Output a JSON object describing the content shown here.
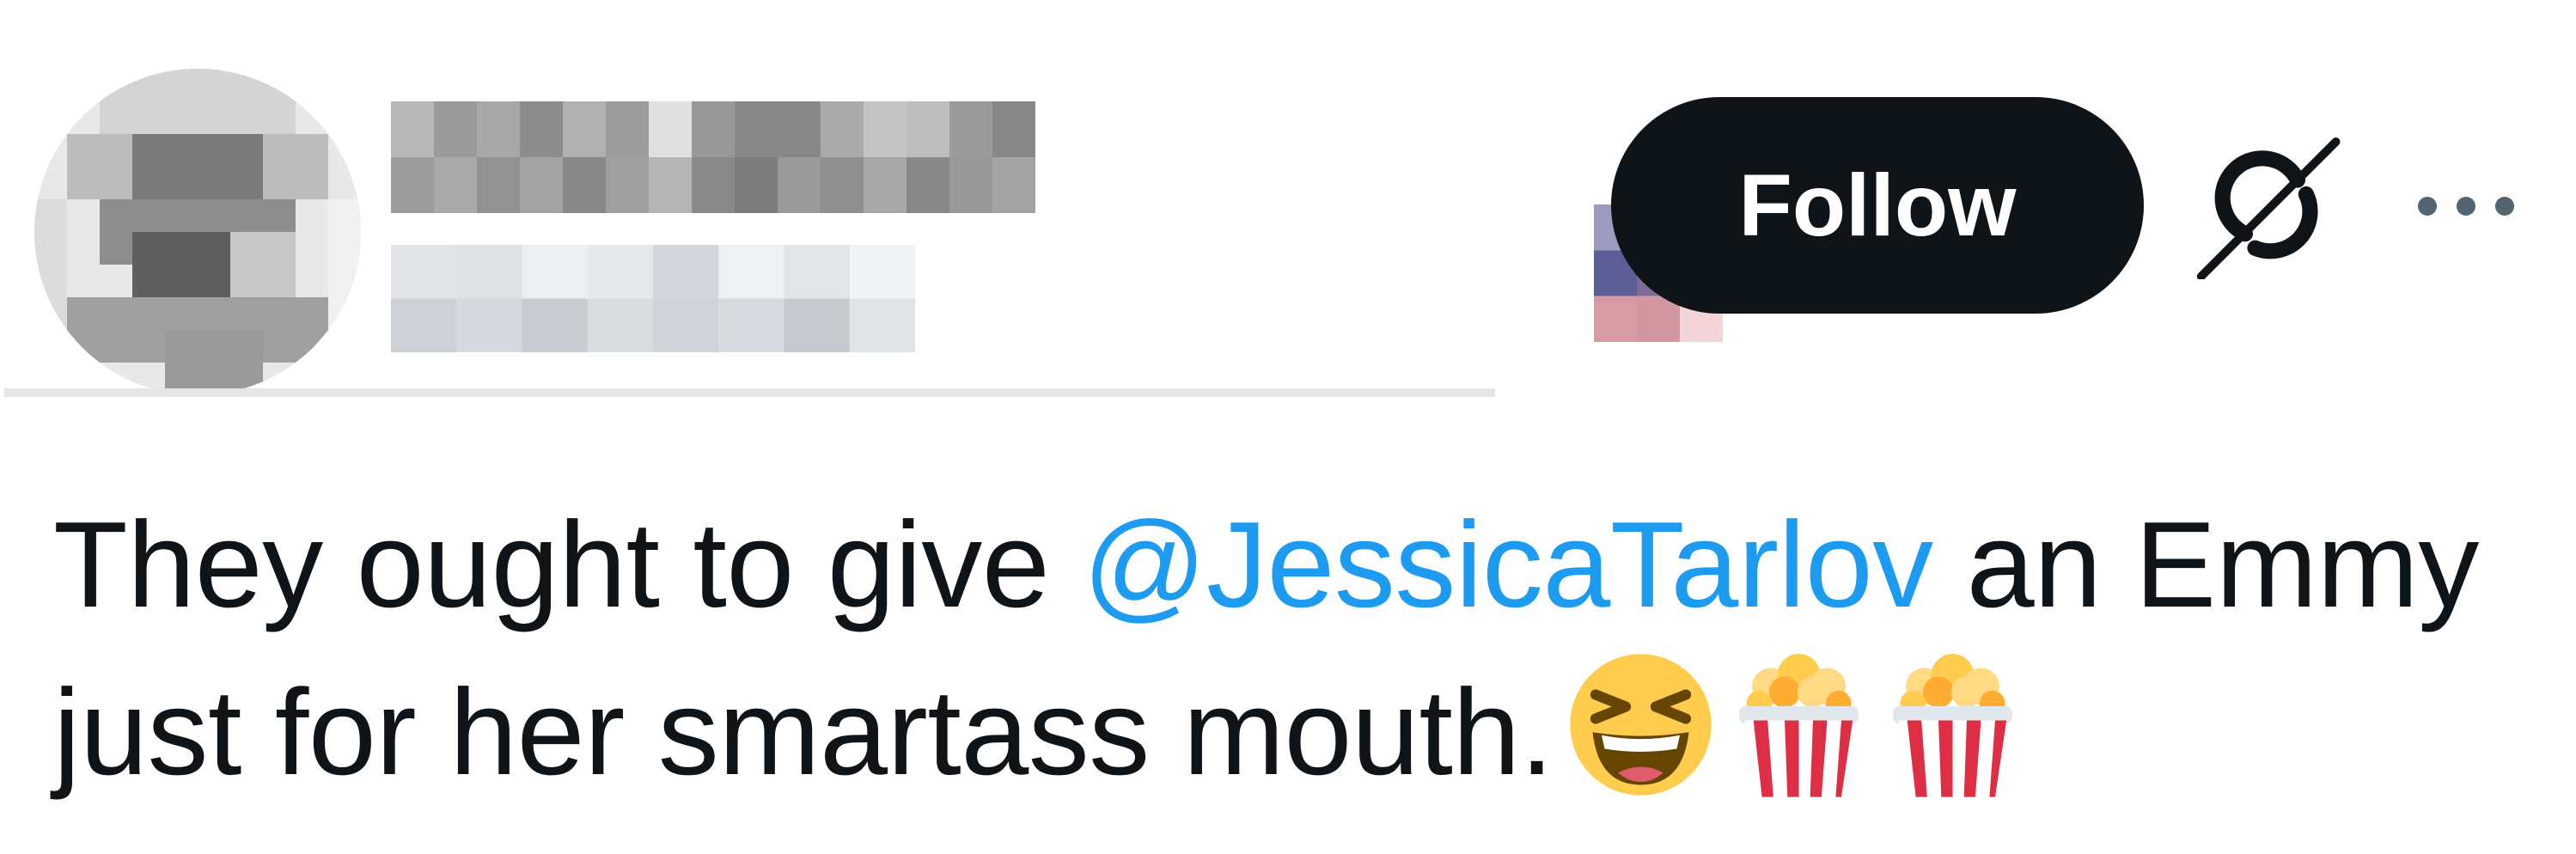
{
  "header": {
    "follow_label": "Follow",
    "grok_icon": "grok-icon",
    "more_icon": "more-horizontal-icon",
    "avatar_icon": "blurred-avatar",
    "flag_icon": "us-flag-icon"
  },
  "tweet": {
    "text_before_mention": "They ought to give ",
    "mention": "@JessicaTarlov",
    "text_after_mention": " an Emmy just for her smartass mouth.",
    "emojis": [
      "grinning-squinting-face-icon",
      "popcorn-icon",
      "popcorn-icon"
    ]
  },
  "colors": {
    "text": "#0f1419",
    "mention": "#1d9bf0",
    "follow_bg": "#0f1419",
    "follow_text": "#ffffff"
  }
}
